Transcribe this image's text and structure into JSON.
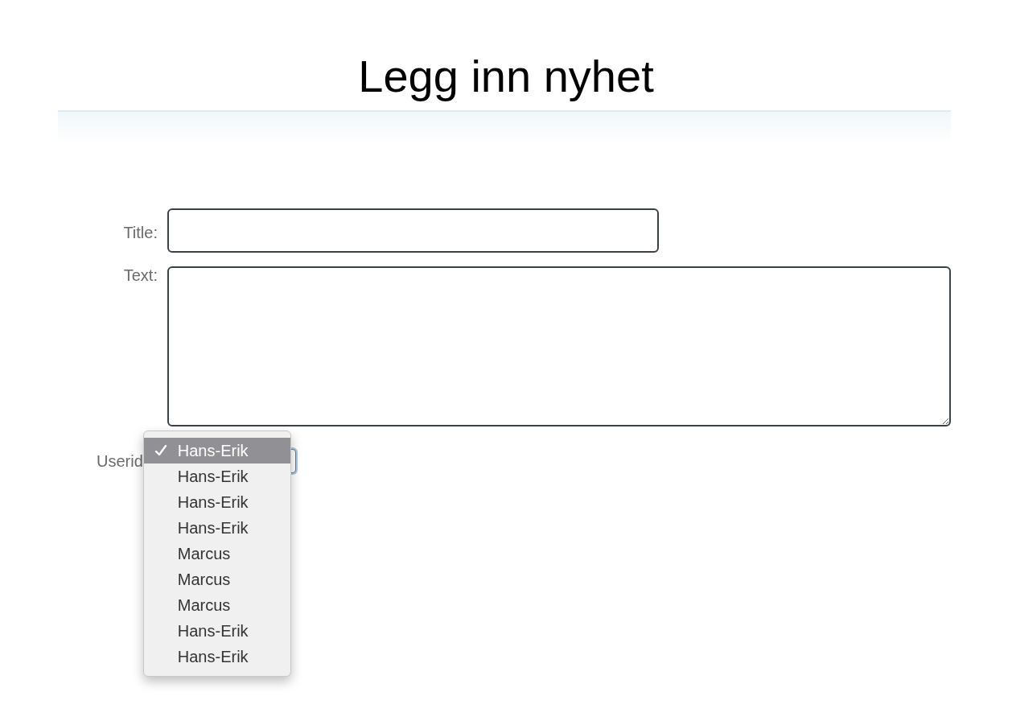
{
  "heading": "Legg inn nyhet",
  "fields": [
    {
      "label": "Title:",
      "kind": "input"
    },
    {
      "label": "Text:",
      "kind": "textarea"
    }
  ],
  "userid": {
    "label": "Userid",
    "expanded": true,
    "options": [
      {
        "label": "Hans-Erik",
        "selected": true
      },
      {
        "label": "Hans-Erik",
        "selected": false
      },
      {
        "label": "Hans-Erik",
        "selected": false
      },
      {
        "label": "Hans-Erik",
        "selected": false
      },
      {
        "label": "Marcus",
        "selected": false
      },
      {
        "label": "Marcus",
        "selected": false
      },
      {
        "label": "Marcus",
        "selected": false
      },
      {
        "label": "Hans-Erik",
        "selected": false
      },
      {
        "label": "Hans-Erik",
        "selected": false
      }
    ]
  }
}
